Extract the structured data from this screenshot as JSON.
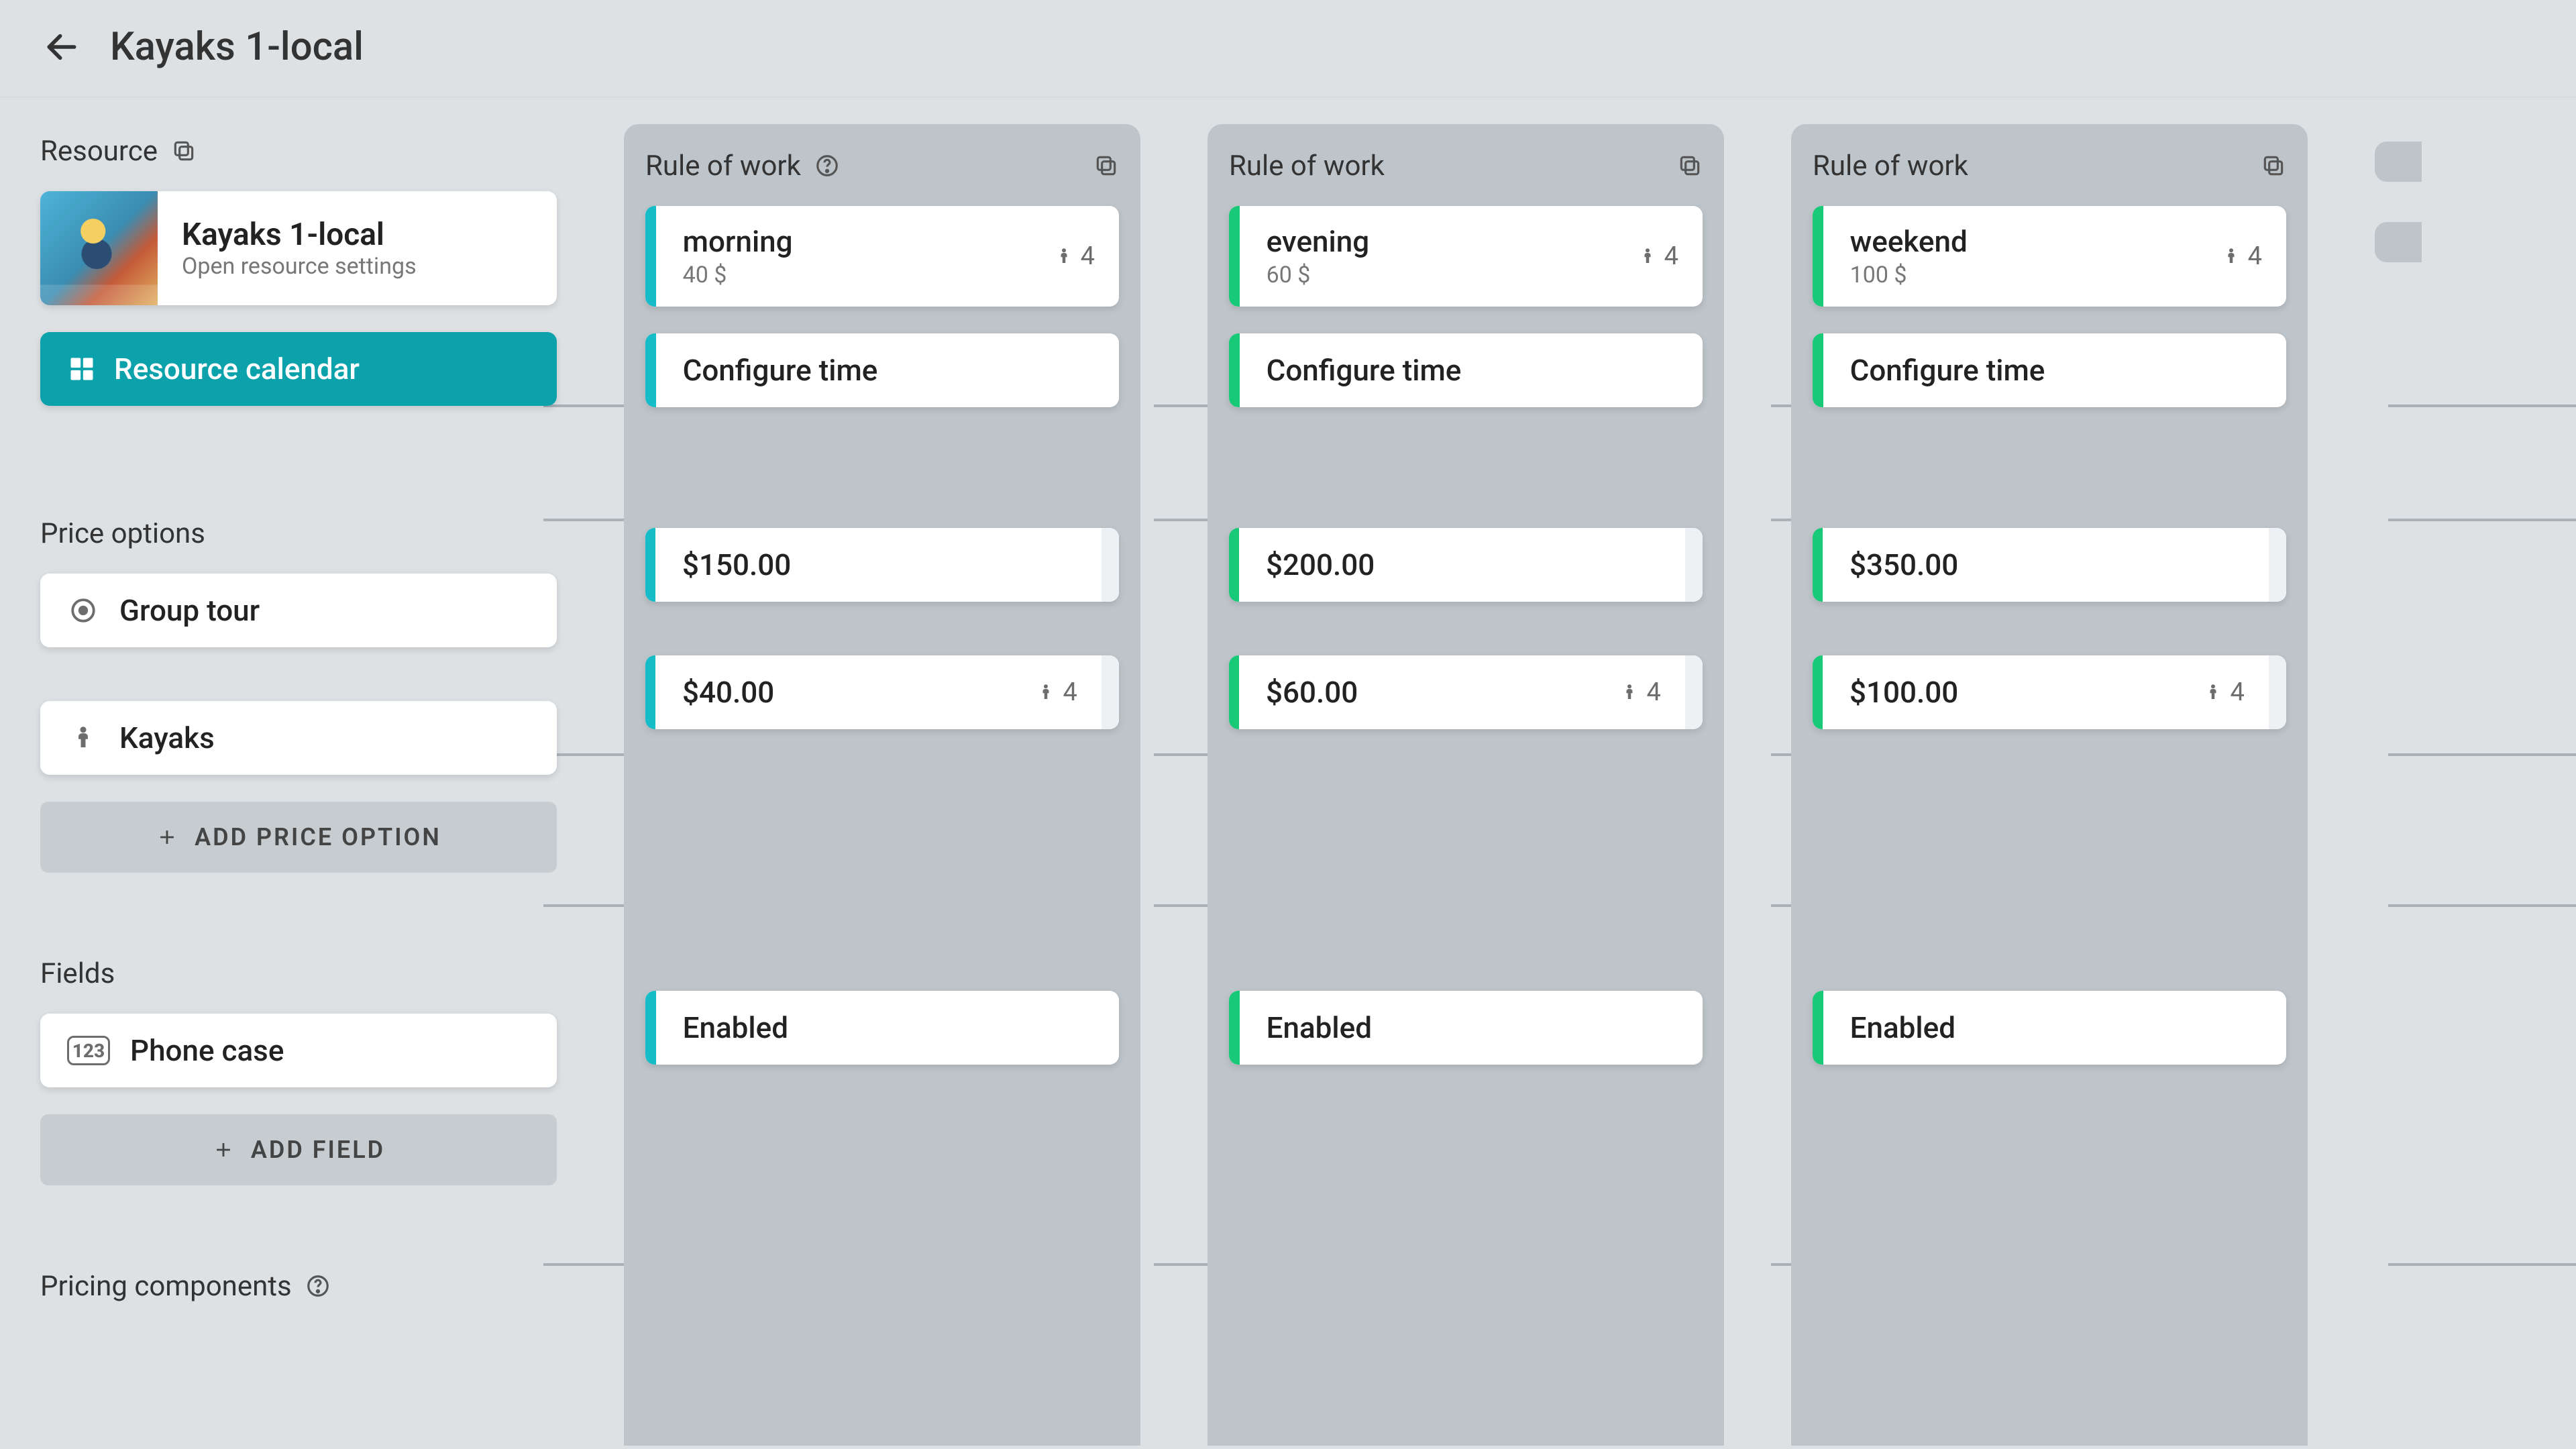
{
  "header": {
    "title": "Kayaks 1-local"
  },
  "sidebar": {
    "section_resource": "Resource",
    "section_price": "Price options",
    "section_fields": "Fields",
    "section_pricing_components": "Pricing components",
    "resource": {
      "name": "Kayaks 1-local",
      "subtitle": "Open resource settings"
    },
    "calendar_btn": "Resource calendar",
    "price_options": [
      {
        "icon": "target",
        "label": "Group tour"
      },
      {
        "icon": "person",
        "label": "Kayaks"
      }
    ],
    "add_price_btn": "ADD PRICE OPTION",
    "fields": [
      {
        "icon": "123",
        "label": "Phone case"
      }
    ],
    "add_field_btn": "ADD FIELD"
  },
  "rule_headers": [
    {
      "title": "Rule of work",
      "help": true
    },
    {
      "title": "Rule of work",
      "help": false
    },
    {
      "title": "Rule of work",
      "help": false
    }
  ],
  "rules": [
    {
      "accent": "teal",
      "name": "morning",
      "rate": "40 $",
      "capacity": "4",
      "configure": "Configure time",
      "prices": [
        {
          "value": "$150.00",
          "capacity": ""
        },
        {
          "value": "$40.00",
          "capacity": "4"
        }
      ],
      "fields": [
        {
          "value": "Enabled"
        }
      ]
    },
    {
      "accent": "green",
      "name": "evening",
      "rate": "60 $",
      "capacity": "4",
      "configure": "Configure time",
      "prices": [
        {
          "value": "$200.00",
          "capacity": ""
        },
        {
          "value": "$60.00",
          "capacity": "4"
        }
      ],
      "fields": [
        {
          "value": "Enabled"
        }
      ]
    },
    {
      "accent": "green",
      "name": "weekend",
      "rate": "100 $",
      "capacity": "4",
      "configure": "Configure time",
      "prices": [
        {
          "value": "$350.00",
          "capacity": ""
        },
        {
          "value": "$100.00",
          "capacity": "4"
        }
      ],
      "fields": [
        {
          "value": "Enabled"
        }
      ]
    }
  ]
}
